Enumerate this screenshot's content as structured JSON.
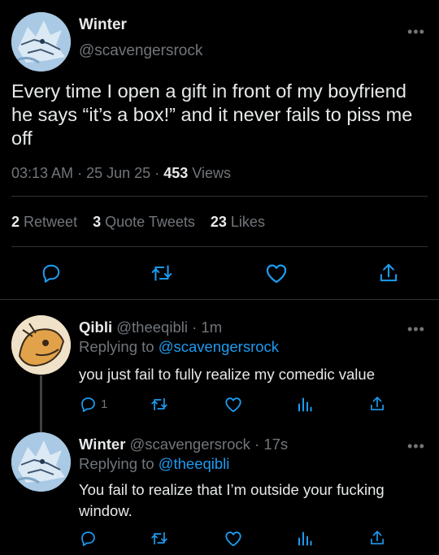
{
  "main_tweet": {
    "name": "Winter",
    "handle": "@scavengersrock",
    "text": "Every time I open a gift in front of my boyfriend he says “it’s a box!” and it never fails to piss me off",
    "time": "03:13 AM",
    "date": "25 Jun 25",
    "views_count": "453",
    "views_label": "Views",
    "retweets_count": "2",
    "retweets_label": "Retweet",
    "quotes_count": "3",
    "quotes_label": "Quote Tweets",
    "likes_count": "23",
    "likes_label": "Likes",
    "more": "•••",
    "separator": "·"
  },
  "replies": [
    {
      "name": "Qibli",
      "handle": "@theeqibli",
      "time": "1m",
      "replying_prefix": "Replying to",
      "replying_to": "@scavengersrock",
      "text": "you just fail to fully realize my comedic value",
      "reply_count": "1",
      "more": "•••"
    },
    {
      "name": "Winter",
      "handle": "@scavengersrock",
      "time": "17s",
      "replying_prefix": "Replying to",
      "replying_to": "@theeqibli",
      "text": "You fail to realize that I’m outside your fucking window.",
      "more": "•••"
    }
  ],
  "icons": [
    "reply-icon",
    "retweet-icon",
    "like-icon",
    "share-icon",
    "analytics-icon",
    "more-icon"
  ],
  "colors": {
    "background": "#000000",
    "text": "#e7e9ea",
    "muted": "#71767b",
    "link": "#1d9bf0",
    "divider": "#2f3336"
  }
}
